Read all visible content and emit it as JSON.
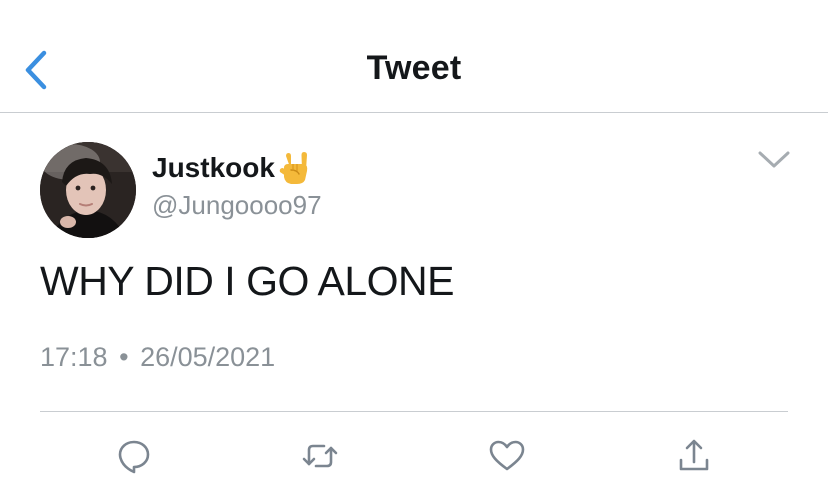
{
  "header": {
    "title": "Tweet",
    "back_icon": "chevron-left-icon"
  },
  "tweet": {
    "display_name": "Justkook",
    "name_emoji": "sign-of-the-horns-emoji",
    "handle": "@Jungoooo97",
    "text": "WHY DID I GO ALONE",
    "time": "17:18",
    "separator": "•",
    "date": "26/05/2021",
    "more_icon": "chevron-down-icon"
  },
  "actions": [
    {
      "name": "reply",
      "icon": "reply-icon"
    },
    {
      "name": "retweet",
      "icon": "retweet-icon"
    },
    {
      "name": "like",
      "icon": "heart-icon"
    },
    {
      "name": "share",
      "icon": "share-icon"
    }
  ],
  "colors": {
    "accent": "#1da1f2",
    "text_primary": "#14171a",
    "text_secondary": "#8a9197",
    "icon": "#7b8590",
    "divider": "#c9cdd1"
  }
}
